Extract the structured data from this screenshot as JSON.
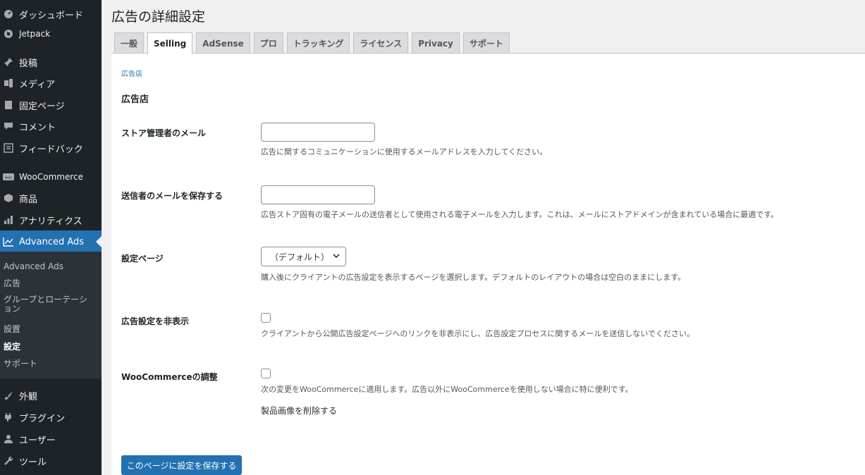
{
  "sidebar": {
    "items": [
      {
        "label": "ダッシュボード",
        "icon": "dashboard-icon"
      },
      {
        "label": "Jetpack",
        "icon": "jetpack-icon"
      },
      {
        "label": "投稿",
        "icon": "pin-icon"
      },
      {
        "label": "メディア",
        "icon": "media-icon"
      },
      {
        "label": "固定ページ",
        "icon": "page-icon"
      },
      {
        "label": "コメント",
        "icon": "comment-icon"
      },
      {
        "label": "フィードバック",
        "icon": "feedback-icon"
      },
      {
        "label": "WooCommerce",
        "icon": "woocommerce-icon"
      },
      {
        "label": "商品",
        "icon": "product-icon"
      },
      {
        "label": "アナリティクス",
        "icon": "analytics-icon"
      },
      {
        "label": "Advanced Ads",
        "icon": "chart-icon"
      },
      {
        "label": "外観",
        "icon": "brush-icon"
      },
      {
        "label": "プラグイン",
        "icon": "plugin-icon"
      },
      {
        "label": "ユーザー",
        "icon": "user-icon"
      },
      {
        "label": "ツール",
        "icon": "wrench-icon"
      }
    ],
    "submenu": {
      "items": [
        {
          "label": "Advanced Ads"
        },
        {
          "label": "広告"
        },
        {
          "label": "グループとローテーション"
        },
        {
          "label": "設置"
        },
        {
          "label": "設定"
        },
        {
          "label": "サポート"
        }
      ]
    }
  },
  "page": {
    "title": "広告の詳細設定",
    "tabs": [
      {
        "label": "一般"
      },
      {
        "label": "Selling"
      },
      {
        "label": "AdSense"
      },
      {
        "label": "プロ"
      },
      {
        "label": "トラッキング"
      },
      {
        "label": "ライセンス"
      },
      {
        "label": "Privacy"
      },
      {
        "label": "サポート"
      }
    ],
    "active_tab": "Selling",
    "breadcrumb": "広告店",
    "section_title": "広告店",
    "fields": {
      "admin_email": {
        "label": "ストア管理者のメール",
        "value": "",
        "description": "広告に関するコミュニケーションに使用するメールアドレスを入力してください。"
      },
      "sender_email": {
        "label": "送信者のメールを保存する",
        "value": "",
        "description": "広告ストア固有の電子メールの送信者として使用される電子メールを入力します。これは、メールにストアドメインが含まれている場合に最適です。"
      },
      "settings_page": {
        "label": "設定ページ",
        "selected": "（デフォルト）",
        "description": "購入後にクライアントの広告設定を表示するページを選択します。デフォルトのレイアウトの場合は空白のままにします。"
      },
      "hide_ad_setup": {
        "label": "広告設定を非表示",
        "checked": false,
        "description": "クライアントから公開広告設定ページへのリンクを非表示にし、広告設定プロセスに関するメールを送信しないでください。"
      },
      "woocommerce_tweaks": {
        "label": "WooCommerceの調整",
        "checked": false,
        "description": "次の変更をWooCommerceに適用します。広告以外にWooCommerceを使用しない場合に特に便利です。",
        "extra": "製品画像を削除する"
      }
    },
    "save_label": "このページに設定を保存する"
  },
  "colors": {
    "sidebar_bg": "#1d2327",
    "submenu_bg": "#2c3338",
    "accent": "#2271b1",
    "page_bg": "#f0f0f1"
  }
}
